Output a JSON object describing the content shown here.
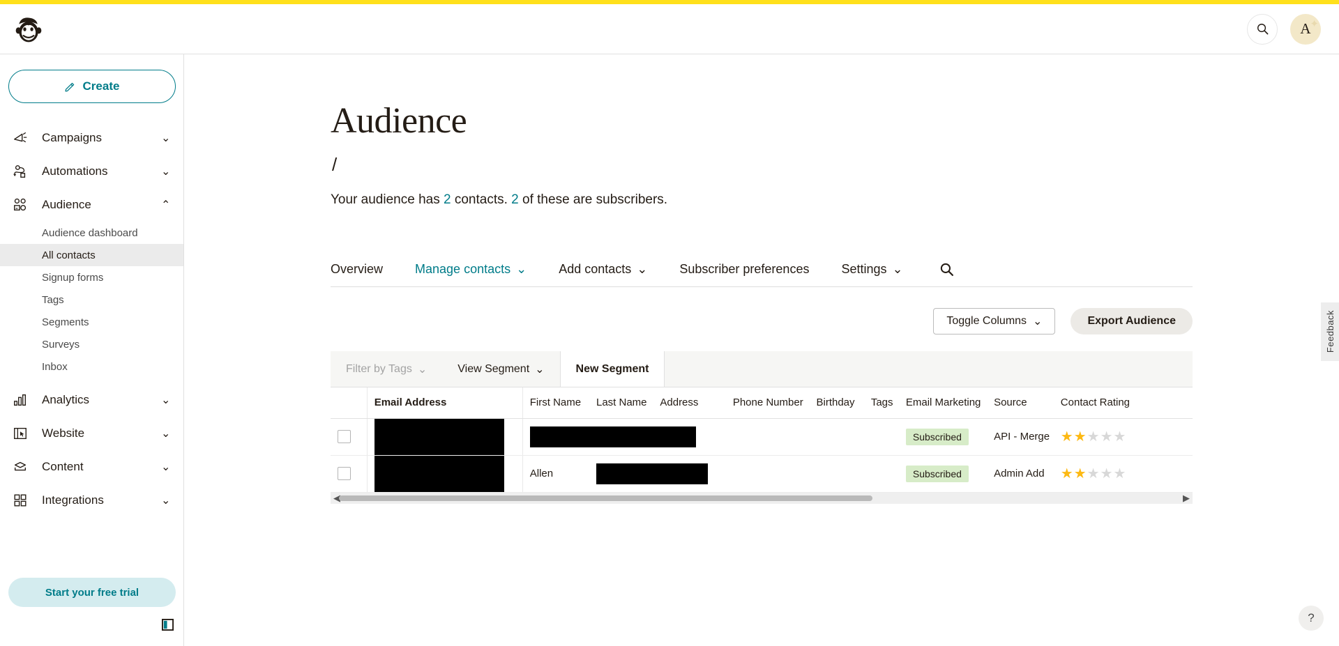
{
  "topbar": {
    "logo_alt": "Mailchimp",
    "search_icon": "search-icon",
    "avatar_initial": "A"
  },
  "sidebar": {
    "create_label": "Create",
    "nav": [
      {
        "label": "Campaigns",
        "icon": "megaphone-icon",
        "chevron": "⌄",
        "expanded": false
      },
      {
        "label": "Automations",
        "icon": "automation-icon",
        "chevron": "⌄",
        "expanded": false
      },
      {
        "label": "Audience",
        "icon": "audience-icon",
        "chevron": "⌃",
        "expanded": true
      },
      {
        "label": "Analytics",
        "icon": "analytics-icon",
        "chevron": "⌄",
        "expanded": false
      },
      {
        "label": "Website",
        "icon": "website-icon",
        "chevron": "⌄",
        "expanded": false
      },
      {
        "label": "Content",
        "icon": "content-icon",
        "chevron": "⌄",
        "expanded": false
      },
      {
        "label": "Integrations",
        "icon": "integrations-icon",
        "chevron": "⌄",
        "expanded": false
      }
    ],
    "audience_sub": [
      {
        "label": "Audience dashboard",
        "active": false
      },
      {
        "label": "All contacts",
        "active": true
      },
      {
        "label": "Signup forms",
        "active": false
      },
      {
        "label": "Tags",
        "active": false
      },
      {
        "label": "Segments",
        "active": false
      },
      {
        "label": "Surveys",
        "active": false
      },
      {
        "label": "Inbox",
        "active": false
      }
    ],
    "trial_label": "Start your free trial",
    "collapse_icon": "collapse-sidebar-icon"
  },
  "main": {
    "title": "Audience",
    "breadcrumb": "/",
    "summary": {
      "prefix": "Your audience has ",
      "contacts_count": "2",
      "middle": " contacts. ",
      "subscribers_count": "2",
      "suffix": " of these are subscribers."
    },
    "tabs": [
      {
        "label": "Overview",
        "active": false,
        "chevron": ""
      },
      {
        "label": "Manage contacts",
        "active": true,
        "chevron": "⌄"
      },
      {
        "label": "Add contacts",
        "active": false,
        "chevron": "⌄"
      },
      {
        "label": "Subscriber preferences",
        "active": false,
        "chevron": ""
      },
      {
        "label": "Settings",
        "active": false,
        "chevron": "⌄"
      }
    ],
    "tab_search_icon": "search-icon",
    "actions": {
      "toggle_columns": "Toggle Columns",
      "toggle_columns_chevron": "⌄",
      "export_audience": "Export Audience"
    },
    "filter_bar": [
      {
        "label": "Filter by Tags",
        "chevron": "⌄",
        "state": "disabled"
      },
      {
        "label": "View Segment",
        "chevron": "⌄",
        "state": "normal"
      },
      {
        "label": "New Segment",
        "chevron": "",
        "state": "tab-new"
      }
    ],
    "table": {
      "columns": [
        "Email Address",
        "First Name",
        "Last Name",
        "Address",
        "Phone Number",
        "Birthday",
        "Tags",
        "Email Marketing",
        "Source",
        "Contact Rating"
      ],
      "rows": [
        {
          "email": "",
          "email_redacted": true,
          "first_name": "",
          "first_name_redacted": true,
          "last_name": "",
          "last_name_redacted": false,
          "address": "",
          "phone": "",
          "birthday": "",
          "tags": "",
          "email_marketing": "Subscribed",
          "source": "API - Merge",
          "rating": 2,
          "rating_max": 5
        },
        {
          "email": "",
          "email_redacted": true,
          "first_name": "Allen",
          "first_name_redacted": false,
          "last_name": "",
          "last_name_redacted": true,
          "address": "",
          "phone": "",
          "birthday": "",
          "tags": "",
          "email_marketing": "Subscribed",
          "source": "Admin Add",
          "rating": 2,
          "rating_max": 5
        }
      ]
    }
  },
  "feedback": {
    "label": "Feedback"
  },
  "help": {
    "label": "?"
  },
  "colors": {
    "brand_yellow": "#ffe01b",
    "teal": "#007c89",
    "dark": "#241c15",
    "badge_green": "#d7ecc8",
    "star_gold": "#fdb913"
  }
}
